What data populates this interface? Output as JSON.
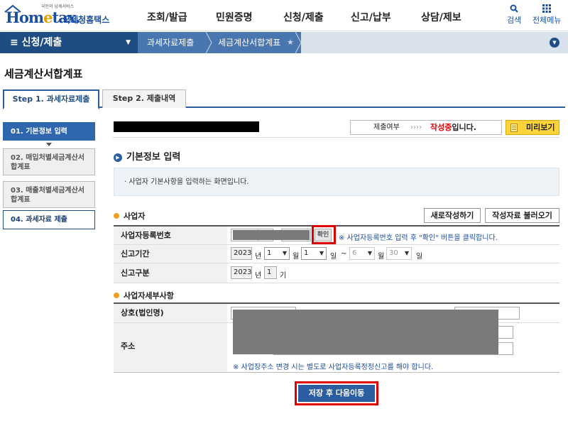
{
  "header": {
    "logo_small": "국민의 납세서비스",
    "logo_text_a": "Hom",
    "logo_text_o": "e",
    "logo_text_b": "tax.",
    "logo_kr": "국세청홈택스",
    "menu": [
      "조회/발급",
      "민원증명",
      "신청/제출",
      "신고/납부",
      "상담/제보"
    ],
    "search_label": "검색",
    "all_menu_label": "전체메뉴"
  },
  "nav": {
    "section": "≡  신청/제출",
    "crumb1": "과세자료제출",
    "crumb2": "세금계산서합계표"
  },
  "page": {
    "title": "세금계산서합계표",
    "tabs": [
      "Step 1. 과세자료제출",
      "Step 2. 제출내역"
    ]
  },
  "steps": [
    "01. 기본정보 입력",
    "02. 매입처별세금계산서합계표",
    "03. 매출처별세금계산서합계표",
    "04. 과세자료 제출"
  ],
  "status": {
    "label": "제출여부",
    "arrows": "›››› ",
    "value": "작성중",
    "suffix": "입니다.",
    "preview": "미리보기"
  },
  "section": {
    "title": "기본정보 입력",
    "info": "· 사업자 기본사항을 입력하는 화면입니다."
  },
  "business": {
    "title": "사업자",
    "new_btn": "새로작성하기",
    "load_btn": "작성자료 불러오기",
    "reg_no_label": "사업자등록번호",
    "confirm_btn": "확인",
    "reg_note": "※ 사업자등록번호 입력 후 \"확인\" 버튼을 클릭합니다.",
    "period_label": "신고기간",
    "year": "2023",
    "year_unit": "년",
    "from_month": "1",
    "month_unit": "월",
    "from_day": "1",
    "day_unit": "일",
    "tilde": "~",
    "to_month": "6",
    "to_day": "30",
    "type_label": "신고구분",
    "type_year": "2023",
    "type_period": "1",
    "type_unit": "기"
  },
  "detail": {
    "title": "사업자세부사항",
    "name_label": "상호(법인명)",
    "address_label": "주소",
    "address_note": "※ 사업장주소 변경 시는 별도로 사업자등록정정신고를 해야 합니다."
  },
  "save_btn": "저장 후 다음이동",
  "colors": {
    "brand": "#1f4c83",
    "accent": "#2b5ea0",
    "highlight": "#e00000",
    "preview": "#ffd43b"
  }
}
